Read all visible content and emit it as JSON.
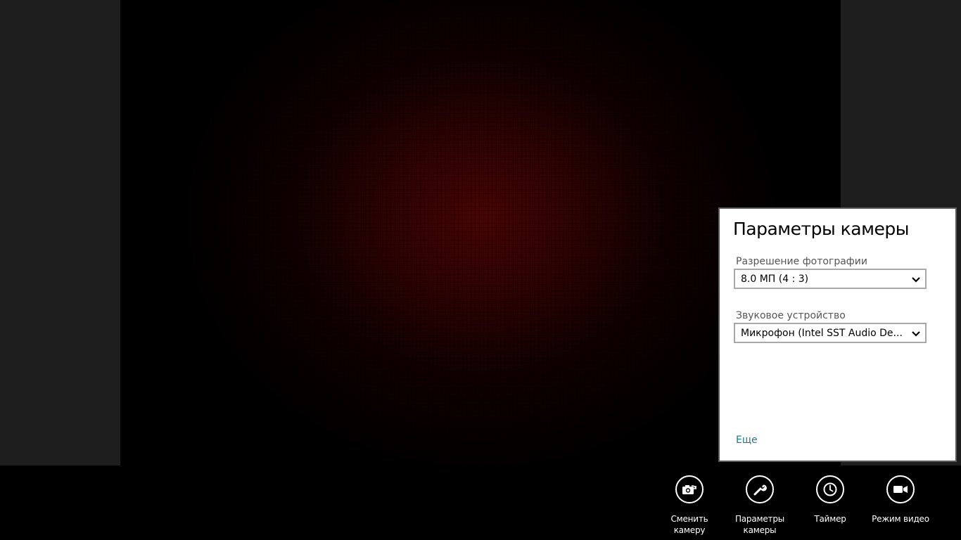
{
  "flyout": {
    "title": "Параметры камеры",
    "photo_resolution": {
      "label": "Разрешение фотографии",
      "value": "8.0 МП (4 : 3)"
    },
    "audio_device": {
      "label": "Звуковое устройство",
      "value": "Микрофон (Intel SST Audio De..."
    },
    "more_link": "Еще"
  },
  "appbar": {
    "buttons": [
      {
        "label": "Сменить камеру",
        "icon": "switch-camera-icon"
      },
      {
        "label": "Параметры камеры",
        "icon": "wrench-icon"
      },
      {
        "label": "Таймер",
        "icon": "clock-icon"
      },
      {
        "label": "Режим видео",
        "icon": "video-camera-icon"
      }
    ]
  },
  "colors": {
    "link": "#1d7a8a",
    "appbar_bg": "#000000",
    "flyout_bg": "#ffffff"
  }
}
